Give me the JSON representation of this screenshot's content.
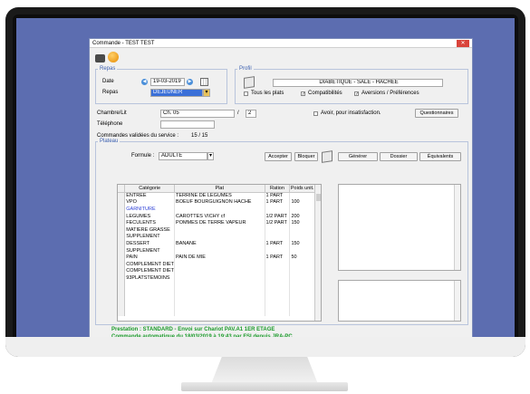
{
  "window": {
    "title": "Commande - TEST TEST",
    "close_label": "✕"
  },
  "repas": {
    "legend": "Repas",
    "date_label": "Date",
    "date_value": "19-03-2019",
    "repas_label": "Repas",
    "repas_value": "DEJEUNER"
  },
  "profil": {
    "legend": "Profil",
    "value": "DIABETIQUE - SALE - HACHEE",
    "tous_plats": "Tous les plats",
    "compatibilites": "Compatibilités",
    "aversions": "Aversions / Préférences"
  },
  "patient": {
    "chambre_label": "Chambre/Lit",
    "chambre_value": "Ch. 05",
    "lit_separator": "/",
    "lit_value": "2",
    "telephone_label": "Téléphone",
    "telephone_value": "",
    "avoir_label": "Avoir, pour insatisfaction.",
    "questionnaires_btn": "Questionnaires",
    "commandes_label": "Commandes validées du service :",
    "commandes_value": "15 / 15"
  },
  "plateau": {
    "legend": "Plateau",
    "formule_label": "Formule :",
    "formule_value": "ADULTE",
    "accepter_btn": "Accepter",
    "bloquer_btn": "Bloquer",
    "generer_btn": "Générer",
    "dossier_btn": "Dossier",
    "equivalents_btn": "Équivalents",
    "columns": [
      "Catégorie",
      "Plat",
      "Ration",
      "Poids unit."
    ],
    "rows": [
      {
        "cat": "ENTREE",
        "plat": "TERRINE DE LEGUMES",
        "ration": "1 PART",
        "poids": "",
        "blue": false
      },
      {
        "cat": "VPO",
        "plat": "BOEUF BOURGUIGNON HACHE",
        "ration": "1 PART",
        "poids": "100",
        "blue": false
      },
      {
        "cat": "GARNITURE",
        "plat": "",
        "ration": "",
        "poids": "",
        "blue": true
      },
      {
        "cat": "LEGUMES",
        "plat": "CAROTTES VICHY cf",
        "ration": "1/2 PART",
        "poids": "200",
        "blue": false
      },
      {
        "cat": "FECULENTS",
        "plat": "POMMES DE TERRE VAPEUR",
        "ration": "1/2 PART",
        "poids": "150",
        "blue": false
      },
      {
        "cat": "MATIERE GRASSE",
        "plat": "",
        "ration": "",
        "poids": "",
        "blue": false
      },
      {
        "cat": "SUPPLEMENT",
        "plat": "",
        "ration": "",
        "poids": "",
        "blue": false
      },
      {
        "cat": "DESSERT",
        "plat": "BANANE",
        "ration": "1 PART",
        "poids": "150",
        "blue": false
      },
      {
        "cat": "SUPPLEMENT",
        "plat": "",
        "ration": "",
        "poids": "",
        "blue": false
      },
      {
        "cat": "PAIN",
        "plat": "PAIN DE MIE",
        "ration": "1 PART",
        "poids": "50",
        "blue": false
      },
      {
        "cat": "COMPLEMENT DIET",
        "plat": "",
        "ration": "",
        "poids": "",
        "blue": false
      },
      {
        "cat": "COMPLEMENT DIET",
        "plat": "",
        "ration": "",
        "poids": "",
        "blue": false
      },
      {
        "cat": "93PLATSTEMOINS",
        "plat": "",
        "ration": "",
        "poids": "",
        "blue": false
      },
      {
        "cat": "",
        "plat": "",
        "ration": "",
        "poids": "",
        "blue": false
      },
      {
        "cat": "",
        "plat": "",
        "ration": "",
        "poids": "",
        "blue": false
      },
      {
        "cat": "",
        "plat": "",
        "ration": "",
        "poids": "",
        "blue": false
      },
      {
        "cat": "",
        "plat": "",
        "ration": "",
        "poids": "",
        "blue": false
      },
      {
        "cat": "",
        "plat": "",
        "ration": "",
        "poids": "",
        "blue": false
      }
    ]
  },
  "status": {
    "line1": "Prestation : STANDARD - Envoi sur   Chariot PAV.A1 1ER ETAGE",
    "line2": "Commande automatique du 18/03/2019 à 19:43 par FSI depuis JRA-PC"
  }
}
